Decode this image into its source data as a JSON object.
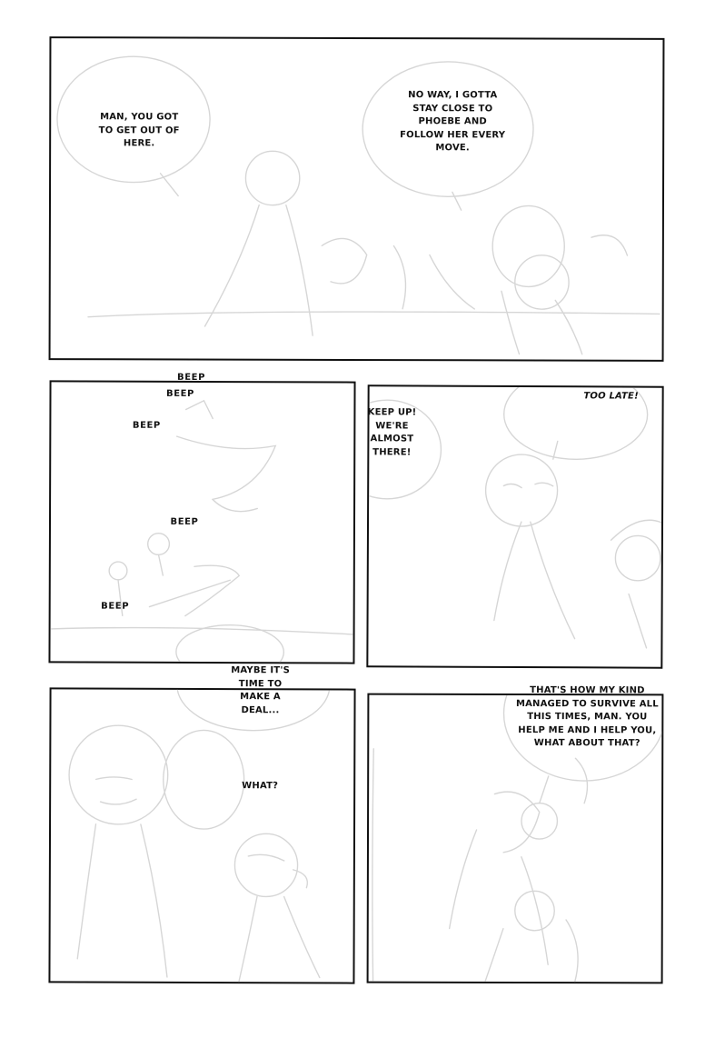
{
  "panels": {
    "p1": {
      "left_balloon": "MAN, YOU GOT\nTO GET OUT OF\nHERE.",
      "right_balloon": "NO WAY, I GOTTA\nSTAY CLOSE TO\nPHOEBE AND\nFOLLOW HER EVERY\nMOVE."
    },
    "p2": {
      "sfx": [
        "BEEP",
        "BEEP",
        "BEEP",
        "BEEP",
        "BEEP"
      ]
    },
    "p3": {
      "balloon": "KEEP UP!\nWE'RE\nALMOST\nTHERE!",
      "shout": "TOO LATE!"
    },
    "p4": {
      "balloon": "MAYBE IT'S\nTIME TO\nMAKE A\nDEAL...",
      "reply": "WHAT?"
    },
    "p5": {
      "balloon": "THAT'S HOW MY KIND\nMANAGED TO SURVIVE ALL\nTHIS TIMES, MAN. YOU\nHELP ME AND I HELP YOU,\nWHAT ABOUT THAT?"
    }
  }
}
